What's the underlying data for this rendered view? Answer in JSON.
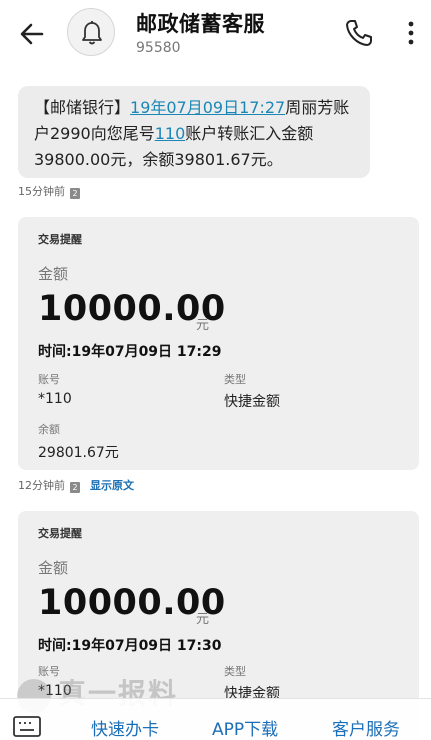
{
  "header": {
    "title": "邮政储蓄客服",
    "number": "95580"
  },
  "message": {
    "prefix": "【邮储银行】",
    "date_link": "19年07月09日17:27",
    "mid1": "周丽芳账户2990向您尾号",
    "acct_link": "110",
    "rest": "账户转账汇入金额39800.00元，余额39801.67元。"
  },
  "meta1": {
    "time": "15分钟前",
    "sim": "2"
  },
  "card1": {
    "title": "交易提醒",
    "amount_label": "金额",
    "amount": "10000.00",
    "unit": "元",
    "time": "时间:19年07月09日 17:29",
    "account_label": "账号",
    "account_value": "*110",
    "type_label": "类型",
    "type_value": "快捷金额",
    "balance_label": "余额",
    "balance_value": "29801.67元"
  },
  "meta2": {
    "time": "12分钟前",
    "sim": "2",
    "link": "显示原文"
  },
  "card2": {
    "title": "交易提醒",
    "amount_label": "金额",
    "amount": "10000.00",
    "unit": "元",
    "time": "时间:19年07月09日 17:30",
    "account_label": "账号",
    "account_value": "*110",
    "type_label": "类型",
    "type_value": "快捷金额"
  },
  "bottom": {
    "btn1": "快速办卡",
    "btn2": "APP下载",
    "btn3": "客户服务"
  },
  "watermark": "真一报料",
  "colors": {
    "link": "#1a87b7",
    "action": "#1b6fb8",
    "bubble": "#ececec"
  }
}
